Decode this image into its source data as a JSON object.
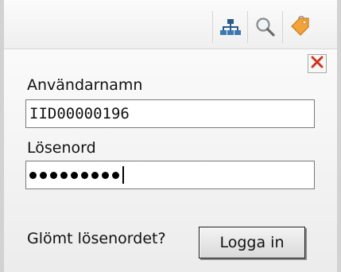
{
  "toolbar": {
    "icons": [
      "sitemap-icon",
      "magnifier-icon",
      "tag-icon"
    ]
  },
  "login": {
    "username_label": "Användarnamn",
    "username_value": "IID00000196",
    "password_label": "Lösenord",
    "password_masked_length": 9,
    "forgot_password_link": "Glömt lösenordet?",
    "submit_label": "Logga in"
  },
  "colors": {
    "close_icon": "#d0341e",
    "sitemap_icon": "#2a5a8c",
    "tag_icon": "#f2a33a",
    "field_border": "#7a7a7a"
  }
}
